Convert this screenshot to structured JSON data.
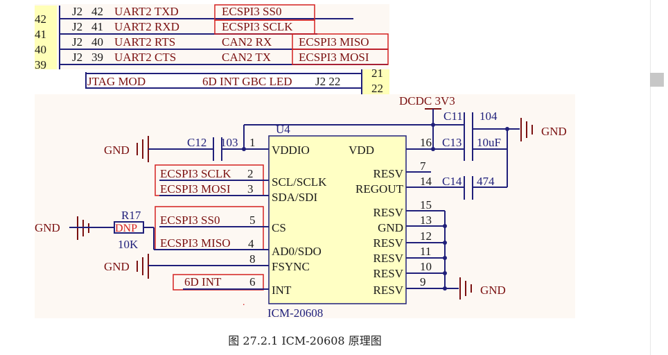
{
  "colors": {
    "wire": "#1f1f7a",
    "label": "#7a1010",
    "box_stroke": "#d42020",
    "chip_fill": "#ffffc4",
    "panel_bg": "#fdf8f3",
    "yellow_tab": "#ffffb8"
  },
  "connector": {
    "pin_numbers": [
      "42",
      "41",
      "40",
      "39"
    ],
    "rows": [
      {
        "ref": "J2",
        "pin": "42",
        "signal": "UART2 TXD",
        "alt1": "ECSPI3 SS0",
        "alt2": ""
      },
      {
        "ref": "J2",
        "pin": "41",
        "signal": "UART2 RXD",
        "alt1": "ECSPI3 SCLK",
        "alt2": ""
      },
      {
        "ref": "J2",
        "pin": "40",
        "signal": "UART2 RTS",
        "alt1": "CAN2 RX",
        "alt2": "ECSPI3 MISO"
      },
      {
        "ref": "J2",
        "pin": "39",
        "signal": "UART2 CTS",
        "alt1": "CAN2 TX",
        "alt2": "ECSPI3 MOSI"
      }
    ],
    "jtag_row": {
      "left": "JTAG MOD",
      "mid": "6D INT GBC LED",
      "ref": "J2 22",
      "pins": [
        "21",
        "22"
      ]
    }
  },
  "chip": {
    "ref": "U4",
    "part": "ICM-20608",
    "left_pins": [
      {
        "num": "1",
        "name": "VDDIO"
      },
      {
        "num": "2",
        "name": "SCL/SCLK"
      },
      {
        "num": "3",
        "name": "SDA/SDI"
      },
      {
        "num": "5",
        "name": "CS"
      },
      {
        "num": "4",
        "name": "AD0/SDO"
      },
      {
        "num": "8",
        "name": "FSYNC"
      },
      {
        "num": "6",
        "name": "INT"
      }
    ],
    "right_pins": [
      {
        "num": "16",
        "name": "VDD"
      },
      {
        "num": "7",
        "name": "RESV"
      },
      {
        "num": "14",
        "name": "REGOUT"
      },
      {
        "num": "15",
        "name": "RESV"
      },
      {
        "num": "13",
        "name": "GND"
      },
      {
        "num": "12",
        "name": "RESV"
      },
      {
        "num": "11",
        "name": "RESV"
      },
      {
        "num": "10",
        "name": "RESV"
      },
      {
        "num": "9",
        "name": "RESV"
      }
    ]
  },
  "net_labels": {
    "sclk": "ECSPI3 SCLK",
    "mosi": "ECSPI3 MOSI",
    "ss0": "ECSPI3 SS0",
    "miso": "ECSPI3 MISO",
    "int": "6D INT"
  },
  "power": {
    "dcdc": "DCDC 3V3",
    "gnd": "GND"
  },
  "capacitors": [
    {
      "ref": "C12",
      "value": "103"
    },
    {
      "ref": "C11",
      "value": "104"
    },
    {
      "ref": "C13",
      "value": "10uF"
    },
    {
      "ref": "C14",
      "value": "474"
    }
  ],
  "resistor": {
    "ref": "R17",
    "dnp": "DNP",
    "value": "10K"
  },
  "stray_mark": ".",
  "caption": "图 27.2.1 ICM-20608 原理图"
}
